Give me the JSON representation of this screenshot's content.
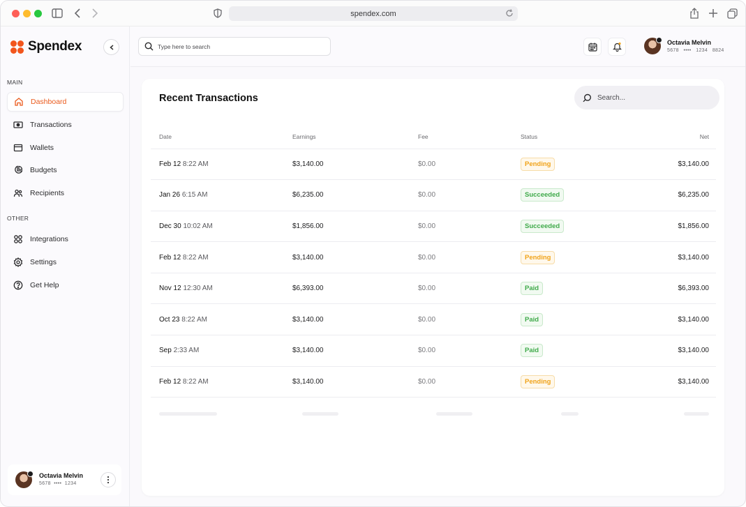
{
  "browser": {
    "url": "spendex.com"
  },
  "app": {
    "name": "Spendex"
  },
  "sidebar": {
    "main_label": "MAIN",
    "other_label": "OTHER",
    "main_items": [
      {
        "label": "Dashboard",
        "icon": "home-icon",
        "active": true
      },
      {
        "label": "Transactions",
        "icon": "banknote-icon"
      },
      {
        "label": "Wallets",
        "icon": "wallet-icon"
      },
      {
        "label": "Budgets",
        "icon": "budgets-icon"
      },
      {
        "label": "Recipients",
        "icon": "users-icon"
      }
    ],
    "other_items": [
      {
        "label": "Integrations",
        "icon": "grid-icon"
      },
      {
        "label": "Settings",
        "icon": "gear-icon"
      },
      {
        "label": "Get Help",
        "icon": "help-icon"
      }
    ],
    "user": {
      "name": "Octavia Melvin",
      "card_start": "5678",
      "card_mask": "••••",
      "card_end": "1234"
    }
  },
  "topbar": {
    "search_placeholder": "Type here to search",
    "user": {
      "name": "Octavia Melvin",
      "card_start": "5678",
      "card_mask": "••••",
      "card_mid": "1234",
      "card_end": "8824"
    }
  },
  "transactions": {
    "title": "Recent Transactions",
    "search_placeholder": "Search...",
    "columns": [
      "Date",
      "Earnings",
      "Fee",
      "Status",
      "Net"
    ],
    "rows": [
      {
        "date": "Feb 12",
        "time": "8:22 AM",
        "earnings": "$3,140.00",
        "fee": "$0.00",
        "status": "Pending",
        "net": "$3,140.00"
      },
      {
        "date": "Jan 26",
        "time": "6:15 AM",
        "earnings": "$6,235.00",
        "fee": "$0.00",
        "status": "Succeeded",
        "net": "$6,235.00"
      },
      {
        "date": "Dec 30",
        "time": "10:02 AM",
        "earnings": "$1,856.00",
        "fee": "$0.00",
        "status": "Succeeded",
        "net": "$1,856.00"
      },
      {
        "date": "Feb 12",
        "time": "8:22 AM",
        "earnings": "$3,140.00",
        "fee": "$0.00",
        "status": "Pending",
        "net": "$3,140.00"
      },
      {
        "date": "Nov 12",
        "time": "12:30 AM",
        "earnings": "$6,393.00",
        "fee": "$0.00",
        "status": "Paid",
        "net": "$6,393.00"
      },
      {
        "date": "Oct 23",
        "time": "8:22 AM",
        "earnings": "$3,140.00",
        "fee": "$0.00",
        "status": "Paid",
        "net": "$3,140.00"
      },
      {
        "date": "Sep",
        "time": "2:33 AM",
        "earnings": "$3,140.00",
        "fee": "$0.00",
        "status": "Paid",
        "net": "$3,140.00"
      },
      {
        "date": "Feb 12",
        "time": "8:22 AM",
        "earnings": "$3,140.00",
        "fee": "$0.00",
        "status": "Pending",
        "net": "$3,140.00"
      }
    ]
  },
  "colors": {
    "brand": "#f2561d",
    "pending": "#f0a31a",
    "success": "#3faa4a"
  }
}
